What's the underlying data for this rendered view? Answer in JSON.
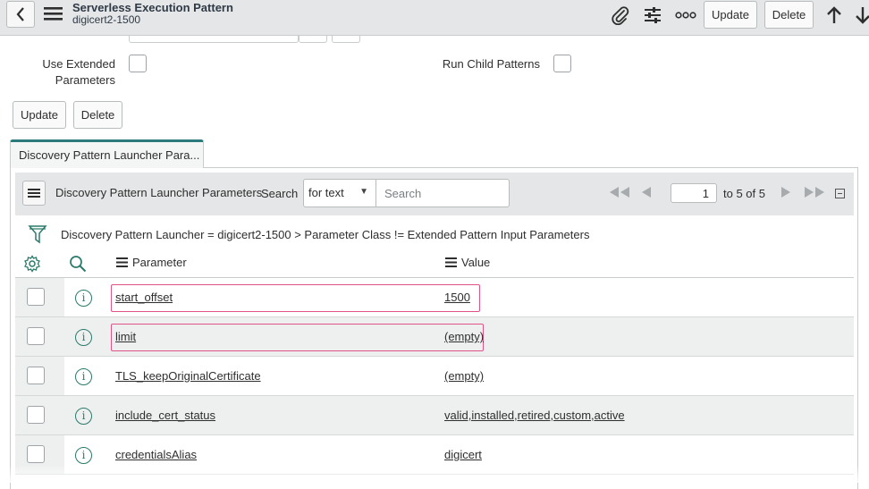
{
  "header": {
    "title": "Serverless Execution Pattern",
    "subtitle": "digicert2-1500",
    "update_label": "Update",
    "delete_label": "Delete"
  },
  "form": {
    "use_extended_label_line1": "Use Extended",
    "use_extended_label_line2": "Parameters",
    "run_child_label": "Run Child Patterns",
    "update_label": "Update",
    "delete_label": "Delete"
  },
  "tab": {
    "label": "Discovery Pattern Launcher Para..."
  },
  "list": {
    "title": "Discovery Pattern Launcher Parameters",
    "search_label": "Search",
    "search_select": "for text",
    "search_placeholder": "Search",
    "page_value": "1",
    "page_of": "to 5 of 5",
    "breadcrumb": "Discovery Pattern Launcher = digicert2-1500  >  Parameter Class != Extended Pattern Input Parameters",
    "col_parameter": "Parameter",
    "col_value": "Value",
    "rows": [
      {
        "parameter": "start_offset",
        "value": "1500"
      },
      {
        "parameter": "limit",
        "value": "(empty)"
      },
      {
        "parameter": "TLS_keepOriginalCertificate",
        "value": "(empty)"
      },
      {
        "parameter": "include_cert_status",
        "value": "valid,installed,retired,custom,active"
      },
      {
        "parameter": "credentialsAlias",
        "value": "digicert"
      }
    ]
  },
  "icons": {
    "back": "chevron-left-icon",
    "menu": "hamburger-icon",
    "attach": "paperclip-icon",
    "settings": "sliders-icon",
    "more": "ellipsis-icon",
    "up": "arrow-up-icon",
    "down": "arrow-down-icon",
    "filter": "funnel-icon",
    "gear": "gear-icon",
    "search": "search-icon",
    "info": "info-icon"
  },
  "colors": {
    "accent": "#2c7a7b",
    "highlight": "#e05389",
    "header_bg": "#e4e6e7"
  }
}
